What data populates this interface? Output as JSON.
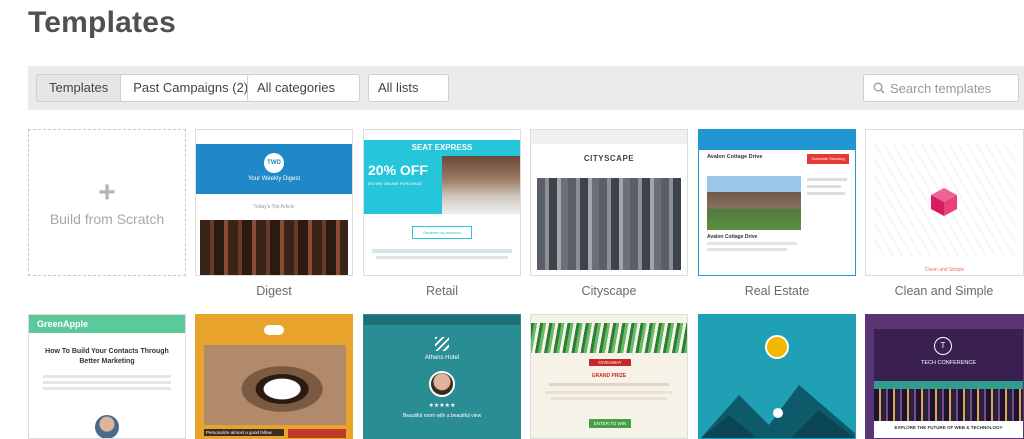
{
  "page": {
    "title": "Templates"
  },
  "toolbar": {
    "tabs": [
      {
        "label": "Templates"
      },
      {
        "label": "Past Campaigns (2)"
      }
    ],
    "categories_label": "All categories",
    "lists_label": "All lists",
    "search_placeholder": "Search templates"
  },
  "scratch": {
    "plus": "+",
    "label": "Build from Scratch"
  },
  "templates": [
    {
      "name": "Digest"
    },
    {
      "name": "Retail"
    },
    {
      "name": "Cityscape"
    },
    {
      "name": "Real Estate"
    },
    {
      "name": "Clean and Simple"
    }
  ],
  "thumbs": {
    "digest": {
      "logo": "TWD",
      "heading": "Your Weekly Digest",
      "sub": "Today's Top Article"
    },
    "retail": {
      "brand": "SEAT EXPRESS",
      "offer": "20% OFF",
      "offer_sub": "ENTIRE ONLINE PURCHASE",
      "button": "Redeem my discount"
    },
    "cityscape": {
      "title": "CITYSCAPE"
    },
    "realestate": {
      "address": "Avalon Cottage Drive",
      "button": "Schedule Showing",
      "address2": "Avalon Cottage Drive"
    },
    "clean": {
      "caption": "Clean and Simple"
    },
    "greenapple": {
      "brand": "GreenApple",
      "headline": "How To Build Your Contacts Through Better Marketing"
    },
    "coffee": {
      "caption": "Personalize almost a good follow"
    },
    "hotel": {
      "name": "Athens Hotel",
      "quote": "Beautiful room with a beautiful view",
      "stars": "★★★★★"
    },
    "holiday": {
      "badge": "GIVEAWAY",
      "title": "GRAND PRIZE",
      "button": "ENTER TO WIN"
    },
    "techconf": {
      "initial": "T",
      "name": "TECH CONFERENCE",
      "headline": "EXPLORE THE FUTURE OF WEB & TECHNOLOGY"
    }
  },
  "colors": {
    "accent_blue": "#1e88c8",
    "retail_teal": "#26c6da",
    "realestate_blue": "#2196d3",
    "greenapple": "#5cc99b",
    "coffee_orange": "#e8a42a",
    "hotel_teal": "#2a8d94",
    "tech_purple": "#5a3575"
  }
}
